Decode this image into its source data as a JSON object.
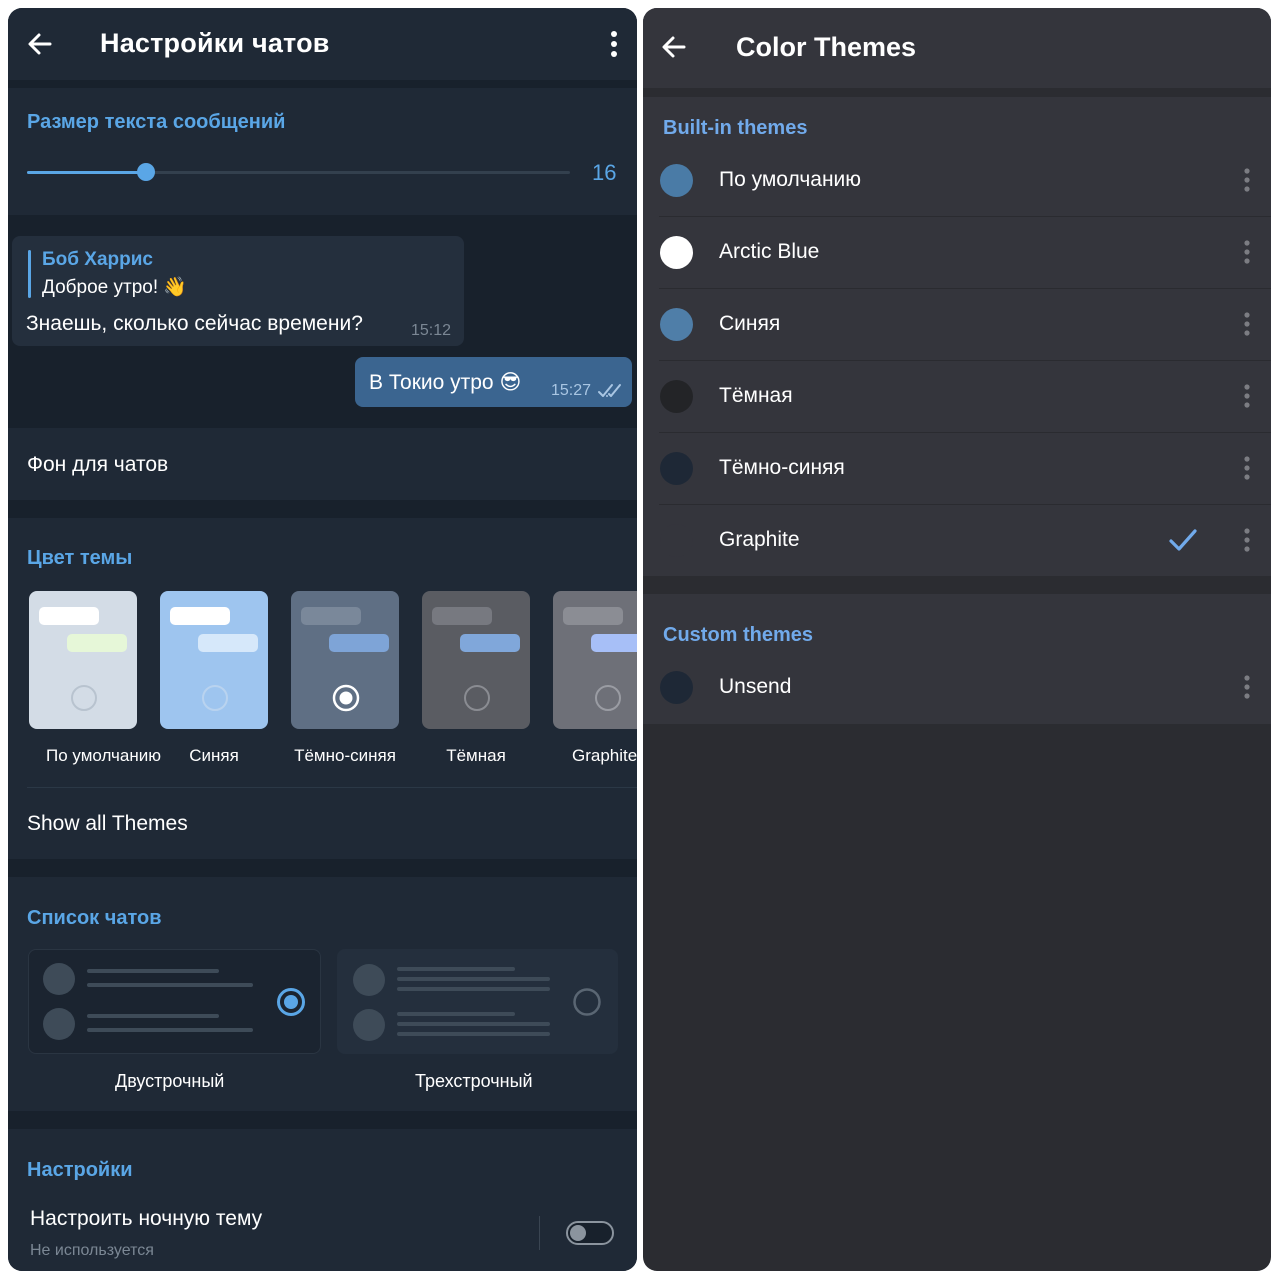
{
  "left": {
    "header": {
      "title": "Настройки чатов"
    },
    "text_size": {
      "title": "Размер текста сообщений",
      "value": "16",
      "fraction": 0.22
    },
    "preview": {
      "reply_name": "Боб Харрис",
      "reply_text": "Доброе утро! 👋",
      "incoming_text": "Знаешь, сколько сейчас времени?",
      "incoming_time": "15:12",
      "outgoing_text": "В Токио утро 😎",
      "outgoing_time": "15:27"
    },
    "background": {
      "label": "Фон для чатов"
    },
    "theme_color": {
      "title": "Цвет темы",
      "themes": [
        {
          "label": "По умолчанию",
          "bg": "#d3dce6",
          "b1": "#ffffff",
          "b2": "#e6f7d8",
          "radio": "#b8c3cf",
          "selected": false
        },
        {
          "label": "Синяя",
          "bg": "#9ec5ef",
          "b1": "#ffffff",
          "b2": "#d6e8fa",
          "radio": "#b9d3ef",
          "selected": false
        },
        {
          "label": "Тёмно-синяя",
          "bg": "#5f6f84",
          "b1": "#7a889a",
          "b2": "#7ea4d7",
          "radio": "#ffffff",
          "selected": true
        },
        {
          "label": "Тёмная",
          "bg": "#5a5c62",
          "b1": "#777980",
          "b2": "#80a7da",
          "radio": "#8a8c92",
          "selected": false
        },
        {
          "label": "Graphite",
          "bg": "#6e7078",
          "b1": "#8b8d94",
          "b2": "#a7bff7",
          "radio": "#9a9ca3",
          "selected": false
        }
      ],
      "show_all": "Show all Themes"
    },
    "chat_list": {
      "title": "Список чатов",
      "two_line": "Двустрочный",
      "three_line": "Трехстрочный",
      "selected": "two_line"
    },
    "settings": {
      "title": "Настройки",
      "night_label": "Настроить ночную тему",
      "night_sub": "Не используется"
    },
    "colors": {
      "accent": "#5aa6e6",
      "bg": "#18212c",
      "card": "#1f2936"
    }
  },
  "right": {
    "header": {
      "title": "Color Themes"
    },
    "builtin_title": "Built-in themes",
    "builtin": [
      {
        "label": "По умолчанию",
        "color": "#4a7ba6",
        "checked": false
      },
      {
        "label": "Arctic Blue",
        "color": "#ffffff",
        "checked": false
      },
      {
        "label": "Синяя",
        "color": "#4f7ea8",
        "checked": false
      },
      {
        "label": "Тёмная",
        "color": "#232427",
        "checked": false
      },
      {
        "label": "Тёмно-синяя",
        "color": "#1e2836",
        "checked": false
      },
      {
        "label": "Graphite",
        "color": "#34353c",
        "checked": true
      }
    ],
    "custom_title": "Custom themes",
    "custom": [
      {
        "label": "Unsend",
        "color": "#1e2836"
      }
    ],
    "colors": {
      "accent": "#71aaeb",
      "bg": "#2b2c31",
      "card": "#34353c"
    }
  }
}
